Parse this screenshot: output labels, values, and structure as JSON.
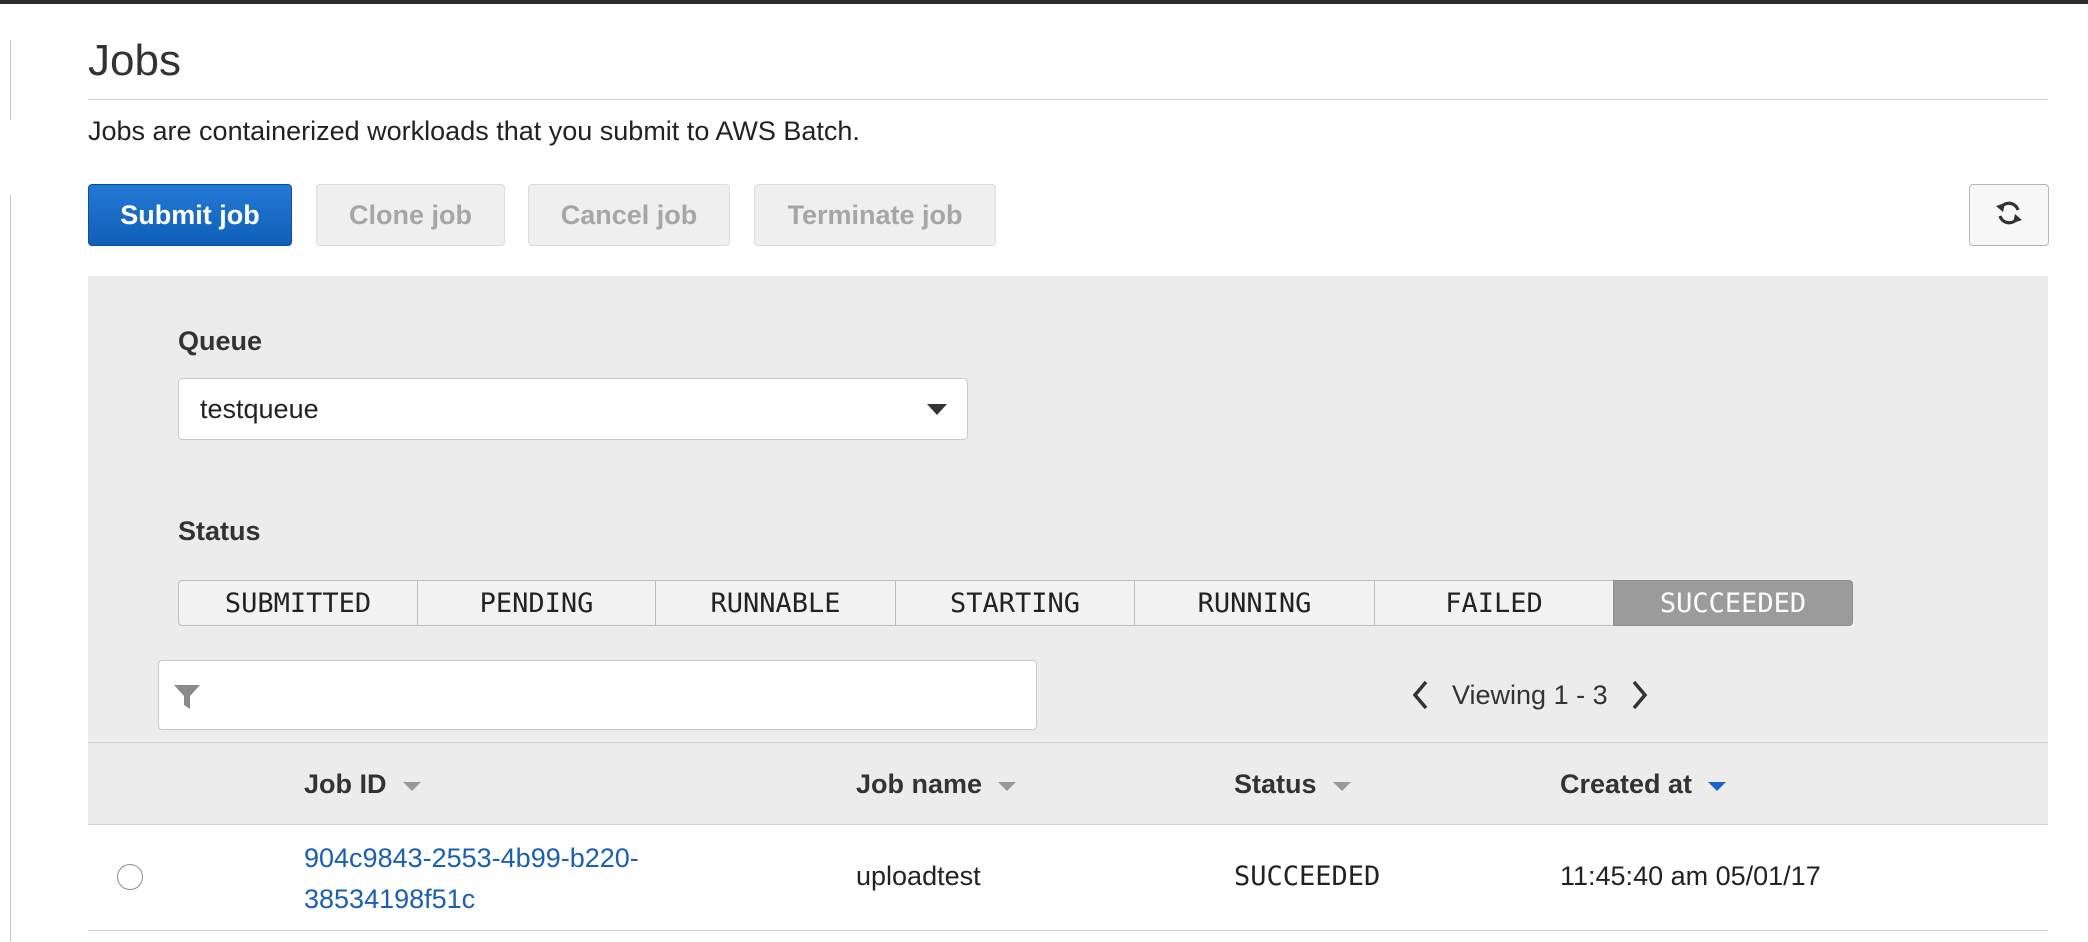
{
  "page": {
    "title": "Jobs",
    "description": "Jobs are containerized workloads that you submit to AWS Batch."
  },
  "toolbar": {
    "submit_label": "Submit job",
    "clone_label": "Clone job",
    "cancel_label": "Cancel job",
    "terminate_label": "Terminate job",
    "refresh_icon": "refresh-icon"
  },
  "filters": {
    "queue_label": "Queue",
    "queue_value": "testqueue",
    "status_label": "Status",
    "statuses": [
      "SUBMITTED",
      "PENDING",
      "RUNNABLE",
      "STARTING",
      "RUNNING",
      "FAILED",
      "SUCCEEDED"
    ],
    "selected_status": "SUCCEEDED",
    "search_value": "",
    "pager_text": "Viewing 1 - 3"
  },
  "table": {
    "columns": {
      "job_id": "Job ID",
      "job_name": "Job name",
      "status": "Status",
      "created_at": "Created at"
    },
    "sorted_by": "created_at",
    "rows": [
      {
        "job_id": "904c9843-2553-4b99-b220-38534198f51c",
        "job_name": "uploadtest",
        "status": "SUCCEEDED",
        "created_at": "11:45:40 am 05/01/17"
      }
    ]
  },
  "colors": {
    "primary": "#1a66c2",
    "link": "#1a5fb0",
    "panel": "#ececec",
    "active_segment": "#9b9b9b"
  }
}
